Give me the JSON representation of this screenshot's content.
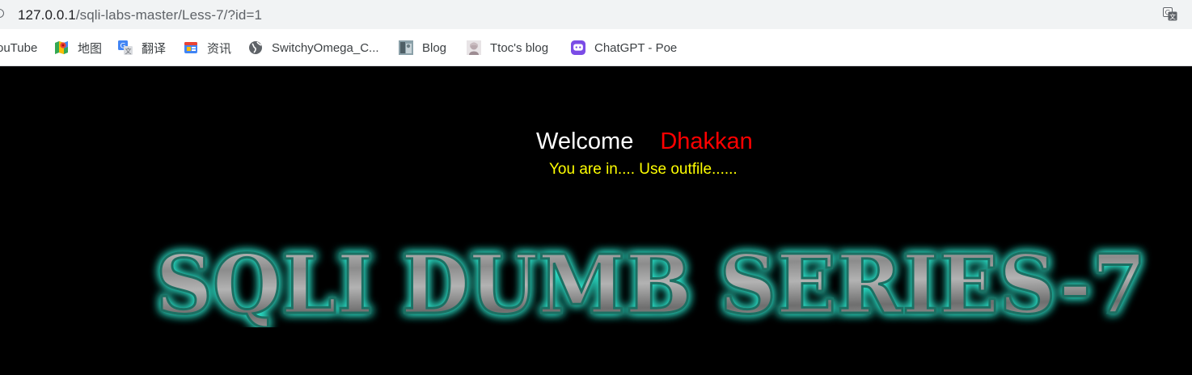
{
  "browser": {
    "url_host": "127.0.0.1",
    "url_path": "/sqli-labs-master/Less-7/?id=1",
    "bookmarks": [
      {
        "label": "ouTube",
        "icon": "youtube-icon"
      },
      {
        "label": "地图",
        "icon": "maps-icon"
      },
      {
        "label": "翻译",
        "icon": "translate-icon"
      },
      {
        "label": "资讯",
        "icon": "news-icon"
      },
      {
        "label": "SwitchyOmega_C...",
        "icon": "globe-icon"
      },
      {
        "label": "Blog",
        "icon": "blog-avatar-icon"
      },
      {
        "label": "Ttoc's blog",
        "icon": "ttoc-avatar-icon"
      },
      {
        "label": "ChatGPT - Poe",
        "icon": "poe-icon"
      }
    ]
  },
  "page": {
    "welcome": "Welcome",
    "name": "Dhakkan",
    "status": "You are in.... Use outfile......",
    "banner_text": "SQLI DUMB SERIES-7",
    "colors": {
      "background": "#000000",
      "welcome": "#ffffff",
      "name": "#ff0000",
      "status": "#ffff00",
      "banner_glow": "#2de0c8",
      "banner_fill": "#9a9a9a"
    }
  }
}
